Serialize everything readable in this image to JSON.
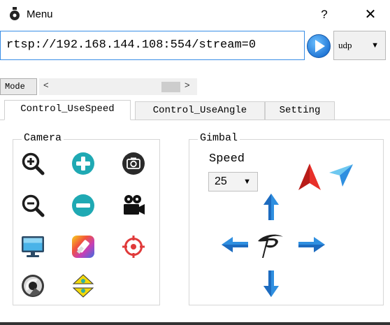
{
  "window": {
    "title": "Menu",
    "help_label": "?",
    "close_label": "✕"
  },
  "stream": {
    "url": "rtsp://192.168.144.108:554/stream=0",
    "protocol": "udp",
    "dropdown_arrow": "▼"
  },
  "mode": {
    "label": "Mode",
    "scroll_left": "<",
    "scroll_right": ">"
  },
  "tabs": [
    {
      "label": "Control_UseSpeed",
      "active": true
    },
    {
      "label": "Control_UseAngle",
      "active": false
    },
    {
      "label": "Setting",
      "active": false
    }
  ],
  "camera": {
    "title": "Camera",
    "icons": [
      "zoom-in-icon",
      "plus-icon",
      "camera-icon",
      "zoom-out-icon",
      "minus-icon",
      "video-camera-icon",
      "monitor-icon",
      "color-palette-icon",
      "target-icon",
      "lens-icon",
      "tilt-arrows-icon"
    ]
  },
  "gimbal": {
    "title": "Gimbal",
    "speed_label": "Speed",
    "speed_value": "25",
    "dropdown_arrow": "▼",
    "icons": [
      "arrow-up-icon",
      "arrow-down-icon",
      "arrow-left-icon",
      "arrow-right-icon",
      "logo-icon",
      "red-pointer-icon",
      "blue-pointer-icon"
    ]
  },
  "colors": {
    "accent_blue": "#2f8fe0",
    "teal": "#1fa9b3",
    "red": "#e5342c",
    "dark": "#1d1d1d"
  }
}
